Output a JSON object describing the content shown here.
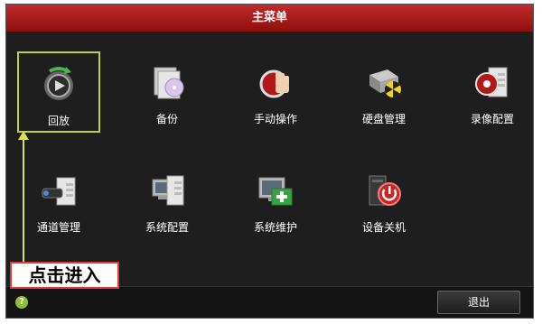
{
  "title": "主菜单",
  "menu": {
    "items": [
      {
        "label": "回放",
        "icon": "playback-icon"
      },
      {
        "label": "备份",
        "icon": "backup-icon"
      },
      {
        "label": "手动操作",
        "icon": "manual-operation-icon"
      },
      {
        "label": "硬盘管理",
        "icon": "disk-management-icon"
      },
      {
        "label": "录像配置",
        "icon": "record-config-icon"
      },
      {
        "label": "通道管理",
        "icon": "channel-management-icon"
      },
      {
        "label": "系统配置",
        "icon": "system-config-icon"
      },
      {
        "label": "系统维护",
        "icon": "system-maintenance-icon"
      },
      {
        "label": "设备关机",
        "icon": "shutdown-icon"
      }
    ]
  },
  "footer": {
    "exit_label": "退出",
    "help_label": "?"
  },
  "annotation": {
    "text": "点击进入"
  },
  "colors": {
    "title_bar": "#b81f1f",
    "selection": "#b7d23a",
    "callout_border": "#e43a3a"
  }
}
